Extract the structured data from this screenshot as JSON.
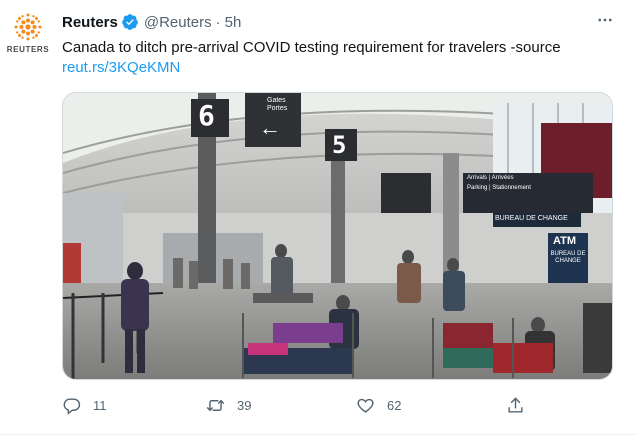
{
  "tweet": {
    "author_name": "Reuters",
    "handle": "@Reuters",
    "separator": "·",
    "time": "5h",
    "avatar_label": "REUTERS",
    "text": "Canada to ditch pre-arrival COVID testing requirement for travelers -source",
    "link": "reut.rs/3KQeKMN"
  },
  "media": {
    "gate_number": "6",
    "gates_sign": "Gates\nPortes",
    "gate_number_2": "5",
    "arrivals_sign": "Arrivals | Arrivées",
    "parking_sign": "Parking | Stationnement",
    "exchange_banner": "BUREAU DE CHANGE",
    "atm_sign": "ATM",
    "atm_sub": "BUREAU DE CHANGE"
  },
  "actions": {
    "replies": "11",
    "retweets": "39",
    "likes": "62"
  },
  "colors": {
    "brand_orange": "#f28a1c",
    "verified_blue": "#1d9bf0",
    "link_blue": "#1d9bf0",
    "muted": "#536471"
  },
  "icons": [
    "reuters-logo-icon",
    "verified-badge-icon",
    "more-icon",
    "reply-icon",
    "retweet-icon",
    "like-icon",
    "share-icon"
  ]
}
